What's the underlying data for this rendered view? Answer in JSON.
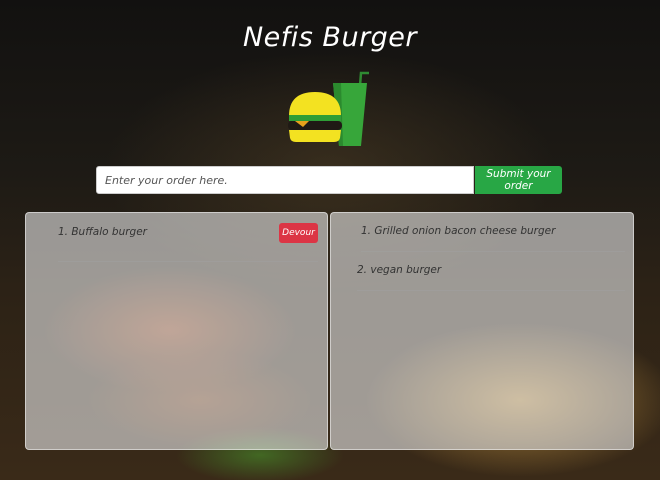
{
  "header": {
    "title": "Nefis Burger"
  },
  "logo": {
    "icon": "burger-drink-icon"
  },
  "order_form": {
    "placeholder": "Enter your order here.",
    "value": "",
    "submit_label": "Submit your order"
  },
  "not_devoured": {
    "items": [
      {
        "label": "1. Buffalo burger",
        "action_label": "Devour"
      }
    ]
  },
  "devoured": {
    "items": [
      {
        "label": "1. Grilled onion bacon cheese burger"
      },
      {
        "label": "2. vegan burger"
      }
    ]
  },
  "colors": {
    "submit_button": "#28a745",
    "devour_button": "#dc3545",
    "bun": "#f3e221",
    "cup": "#37a63a"
  }
}
